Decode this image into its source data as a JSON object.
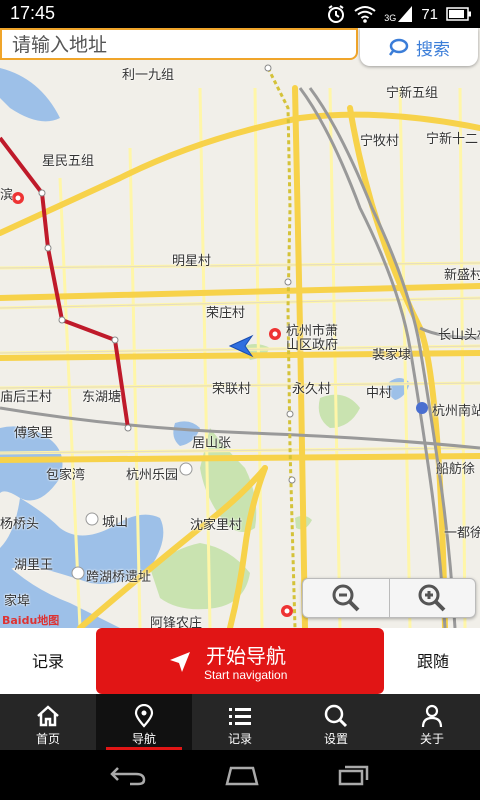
{
  "status_bar": {
    "time": "17:45",
    "network": "3G",
    "battery": "71"
  },
  "search": {
    "placeholder": "请输入地址",
    "button_label": "搜索"
  },
  "map": {
    "labels": [
      {
        "text": "利一九组"
      },
      {
        "text": "宁新五组"
      },
      {
        "text": "宁牧村"
      },
      {
        "text": "宁新十二"
      },
      {
        "text": "星民五组"
      },
      {
        "text": "滨"
      },
      {
        "text": "明星村"
      },
      {
        "text": "新盛村"
      },
      {
        "text": "荣庄村"
      },
      {
        "text": "杭州市萧"
      },
      {
        "text": "山区政府"
      },
      {
        "text": "长山头村"
      },
      {
        "text": "裴家埭"
      },
      {
        "text": "庙后王村"
      },
      {
        "text": "东湖塘"
      },
      {
        "text": "荣联村"
      },
      {
        "text": "永久村"
      },
      {
        "text": "中村"
      },
      {
        "text": "杭州南站"
      },
      {
        "text": "傅家里"
      },
      {
        "text": "居山张"
      },
      {
        "text": "包家湾"
      },
      {
        "text": "杭州乐园"
      },
      {
        "text": "船舫徐"
      },
      {
        "text": "杨桥头"
      },
      {
        "text": "城山"
      },
      {
        "text": "沈家里村"
      },
      {
        "text": "一都徐"
      },
      {
        "text": "湖里王"
      },
      {
        "text": "跨湖桥遗址"
      },
      {
        "text": "家埠"
      },
      {
        "text": "阿锋农庄"
      }
    ],
    "logo_text": "Baidu地图"
  },
  "actions": {
    "record_label": "记录",
    "start_nav_main": "开始导航",
    "start_nav_sub": "Start navigation",
    "follow_label": "跟随"
  },
  "tabs": [
    {
      "label": "首页",
      "icon": "home-icon"
    },
    {
      "label": "导航",
      "icon": "location-pin-icon",
      "active": true
    },
    {
      "label": "记录",
      "icon": "list-icon"
    },
    {
      "label": "设置",
      "icon": "search-icon"
    },
    {
      "label": "关于",
      "icon": "person-icon"
    }
  ],
  "colors": {
    "accent_red": "#e11515",
    "search_border": "#f0a52a",
    "search_blue": "#3b7dd8",
    "tab_bar": "#262626"
  }
}
